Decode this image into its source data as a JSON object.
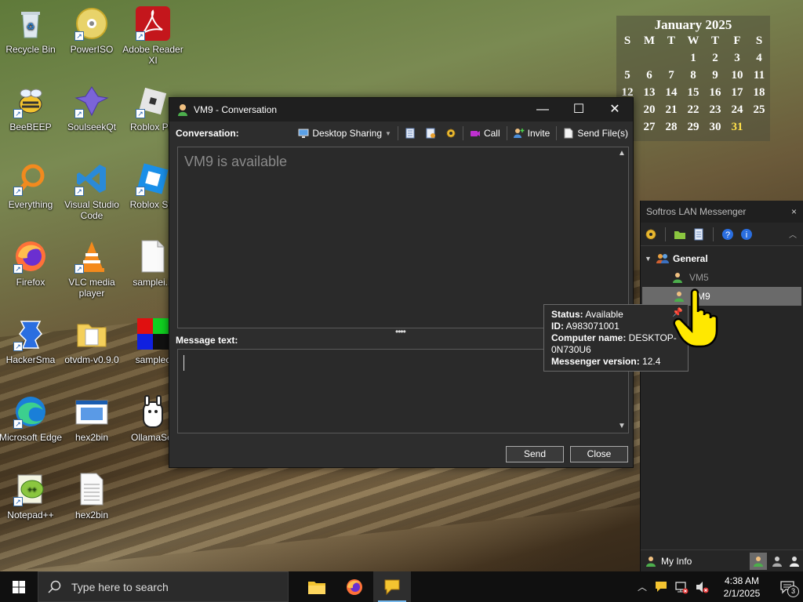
{
  "desktop_icons": [
    {
      "label": "Recycle Bin",
      "icon": "recycle-bin-icon"
    },
    {
      "label": "PowerISO",
      "icon": "poweriso-icon"
    },
    {
      "label": "Adobe Reader XI",
      "icon": "adobe-reader-icon"
    },
    {
      "label": "BeeBEEP",
      "icon": "beebeep-icon"
    },
    {
      "label": "SoulseekQt",
      "icon": "soulseek-icon"
    },
    {
      "label": "Roblox Pla",
      "icon": "roblox-player-icon"
    },
    {
      "label": "Everything",
      "icon": "everything-search-icon"
    },
    {
      "label": "Visual Studio Code",
      "icon": "vscode-icon"
    },
    {
      "label": "Roblox Stu",
      "icon": "roblox-studio-icon"
    },
    {
      "label": "Firefox",
      "icon": "firefox-icon"
    },
    {
      "label": "VLC media player",
      "icon": "vlc-icon"
    },
    {
      "label": "samplei.h",
      "icon": "file-icon"
    },
    {
      "label": "HackerSma",
      "icon": "hackersmacker-icon"
    },
    {
      "label": "otvdm-v0.9.0",
      "icon": "folder-icon"
    },
    {
      "label": "samplec",
      "icon": "rgb-image-icon"
    },
    {
      "label": "Microsoft Edge",
      "icon": "edge-icon"
    },
    {
      "label": "hex2bin",
      "icon": "hex2bin-app-icon"
    },
    {
      "label": "OllamaSet",
      "icon": "ollama-icon"
    },
    {
      "label": "Notepad++",
      "icon": "notepadpp-icon"
    },
    {
      "label": "hex2bin",
      "icon": "text-file-icon"
    }
  ],
  "calendar": {
    "title": "January 2025",
    "weekdays": [
      "S",
      "M",
      "T",
      "W",
      "T",
      "F",
      "S"
    ],
    "cells": [
      "",
      "",
      "",
      "1",
      "2",
      "3",
      "4",
      "5",
      "6",
      "7",
      "8",
      "9",
      "10",
      "11",
      "12",
      "13",
      "14",
      "15",
      "16",
      "17",
      "18",
      "19",
      "20",
      "21",
      "22",
      "23",
      "24",
      "25",
      "26",
      "27",
      "28",
      "29",
      "30",
      "31",
      ""
    ],
    "today": "31"
  },
  "conversation": {
    "title": "VM9 - Conversation",
    "conversation_label": "Conversation:",
    "desktop_sharing": "Desktop Sharing",
    "call": "Call",
    "invite": "Invite",
    "send_files": "Send File(s)",
    "status_text": "VM9 is available",
    "message_label": "Message text:",
    "send": "Send",
    "close": "Close"
  },
  "messenger": {
    "title": "Softros LAN Messenger",
    "group": "General",
    "contacts": [
      "VM5",
      "VM9"
    ],
    "my_info": "My Info"
  },
  "tooltip": {
    "status_label": "Status:",
    "status_value": " Available",
    "id_label": "ID:",
    "id_value": " A983071001",
    "computer_label": "Computer name:",
    "computer_value": " DESKTOP-0N730U6",
    "version_label": "Messenger version:",
    "version_value": " 12.4"
  },
  "taskbar": {
    "search_placeholder": "Type here to search",
    "time": "4:38 AM",
    "date": "2/1/2025",
    "notification_count": "3"
  },
  "colors": {
    "accent": "#76b9ed",
    "today": "#ffe04a"
  }
}
